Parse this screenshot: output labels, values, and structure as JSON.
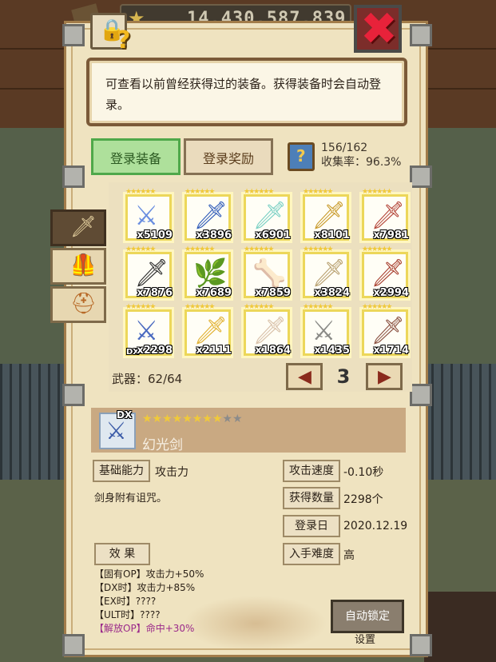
{
  "header": {
    "coins": "14,430,587,839",
    "lock_icon": "lock-help-icon",
    "close_icon": "close-icon"
  },
  "info": {
    "text": "可查看以前曾经获得过的装备。获得装备时会自动登录。"
  },
  "tabs": [
    {
      "label": "登录装备",
      "active": true
    },
    {
      "label": "登录奖励",
      "active": false
    }
  ],
  "collection": {
    "count": "156/162",
    "rate": "收集率：96.3%"
  },
  "categories": [
    {
      "name": "weapon",
      "icon": "sword-icon",
      "active": true
    },
    {
      "name": "armor",
      "icon": "armor-icon",
      "active": false
    },
    {
      "name": "accessory",
      "icon": "helmet-icon",
      "active": false
    }
  ],
  "weapons": [
    {
      "qty": "x5109",
      "icon": "rainbow-sword",
      "dx": ""
    },
    {
      "qty": "x3896",
      "icon": "blue-sword",
      "dx": ""
    },
    {
      "qty": "x6901",
      "icon": "crystal-sword",
      "dx": ""
    },
    {
      "qty": "x8101",
      "icon": "golden-sword",
      "dx": ""
    },
    {
      "qty": "x7981",
      "icon": "rose-sword",
      "dx": ""
    },
    {
      "qty": "x7876",
      "icon": "dark-blade",
      "dx": ""
    },
    {
      "qty": "x7689",
      "icon": "leaf-blade",
      "dx": ""
    },
    {
      "qty": "x7859",
      "icon": "bone-club",
      "dx": ""
    },
    {
      "qty": "x3824",
      "icon": "curved-blade",
      "dx": ""
    },
    {
      "qty": "x2994",
      "icon": "red-dagger",
      "dx": ""
    },
    {
      "qty": "x2298",
      "icon": "phantom-sword",
      "dx": "DX"
    },
    {
      "qty": "x2111",
      "icon": "gold-blade",
      "dx": ""
    },
    {
      "qty": "x1864",
      "icon": "white-sword",
      "dx": ""
    },
    {
      "qty": "x1435",
      "icon": "silver-blade",
      "dx": ""
    },
    {
      "qty": "x1714",
      "icon": "ruby-sword",
      "dx": ""
    }
  ],
  "pager": {
    "weapon_count": "武器：62/64",
    "page": "3",
    "prev": "◀",
    "next": "▶"
  },
  "detail": {
    "dx": "DX",
    "stars_on": "★★★★★★★★",
    "stars_off": "★★",
    "name": "幻光剑",
    "base_ability_label": "基础能力",
    "base_ability_value": "攻击力",
    "description": "剑身附有诅咒。",
    "effect_label": "效 果",
    "attack_speed_label": "攻击速度",
    "attack_speed_value": "-0.10秒",
    "obtained_label": "获得数量",
    "obtained_value": "2298个",
    "register_date_label": "登录日",
    "register_date_value": "2020.12.19",
    "difficulty_label": "入手难度",
    "difficulty_value": "高",
    "effects": [
      {
        "text": "【固有OP】攻击力+50%",
        "purple": false
      },
      {
        "text": "【DX时】攻击力+85%",
        "purple": false
      },
      {
        "text": "【EX时】????",
        "purple": false
      },
      {
        "text": "【ULT时】????",
        "purple": false
      },
      {
        "prefix": "【解放OP】",
        "text": "命中+30%",
        "purple": true
      }
    ]
  },
  "auto_lock": {
    "label": "自动锁定",
    "settings": "设置"
  }
}
